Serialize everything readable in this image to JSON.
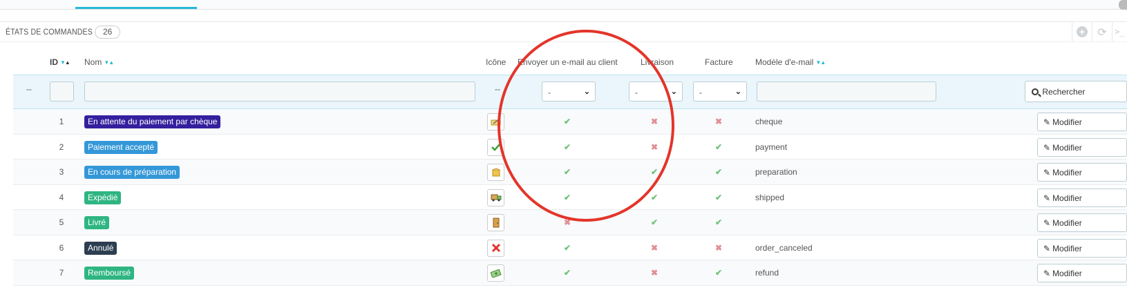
{
  "panel": {
    "title": "ÉTATS DE COMMANDES",
    "count": "26"
  },
  "tools": {
    "add": "+",
    "refresh": "⟳",
    "sql": ">_"
  },
  "columns": {
    "id": "ID",
    "name": "Nom",
    "icon": "Icône",
    "send_email": "Envoyer un e-mail au client",
    "delivery": "Livraison",
    "invoice": "Facture",
    "template": "Modèle d'e-mail"
  },
  "filters": {
    "row_dash": "--",
    "icon_dash": "--",
    "send_email_value": "-",
    "delivery_value": "-",
    "invoice_value": "-",
    "search_label": "Rechercher"
  },
  "rows": [
    {
      "id": "1",
      "name": "En attente du paiement par chèque",
      "color": "#34209e",
      "icon": "cheque-icon",
      "email": true,
      "delivery": false,
      "invoice": false,
      "template": "cheque",
      "edit": "Modifier"
    },
    {
      "id": "2",
      "name": "Paiement accepté",
      "color": "#3498d8",
      "icon": "checkmark-icon",
      "email": true,
      "delivery": false,
      "invoice": true,
      "template": "payment",
      "edit": "Modifier"
    },
    {
      "id": "3",
      "name": "En cours de préparation",
      "color": "#3498d8",
      "icon": "package-icon",
      "email": true,
      "delivery": true,
      "invoice": true,
      "template": "preparation",
      "edit": "Modifier"
    },
    {
      "id": "4",
      "name": "Expédié",
      "color": "#2eb582",
      "icon": "truck-icon",
      "email": true,
      "delivery": true,
      "invoice": true,
      "template": "shipped",
      "edit": "Modifier"
    },
    {
      "id": "5",
      "name": "Livré",
      "color": "#2eb582",
      "icon": "door-icon",
      "email": false,
      "delivery": true,
      "invoice": true,
      "template": "",
      "edit": "Modifier"
    },
    {
      "id": "6",
      "name": "Annulé",
      "color": "#2c3e50",
      "icon": "cancel-icon",
      "email": true,
      "delivery": false,
      "invoice": false,
      "template": "order_canceled",
      "edit": "Modifier"
    },
    {
      "id": "7",
      "name": "Remboursé",
      "color": "#2eb582",
      "icon": "money-icon",
      "email": true,
      "delivery": false,
      "invoice": true,
      "template": "refund",
      "edit": "Modifier"
    }
  ],
  "colors": {
    "accent": "#25b9d7",
    "annotation": "#e3352a",
    "ok": "#72c279",
    "no": "#e08f95"
  }
}
